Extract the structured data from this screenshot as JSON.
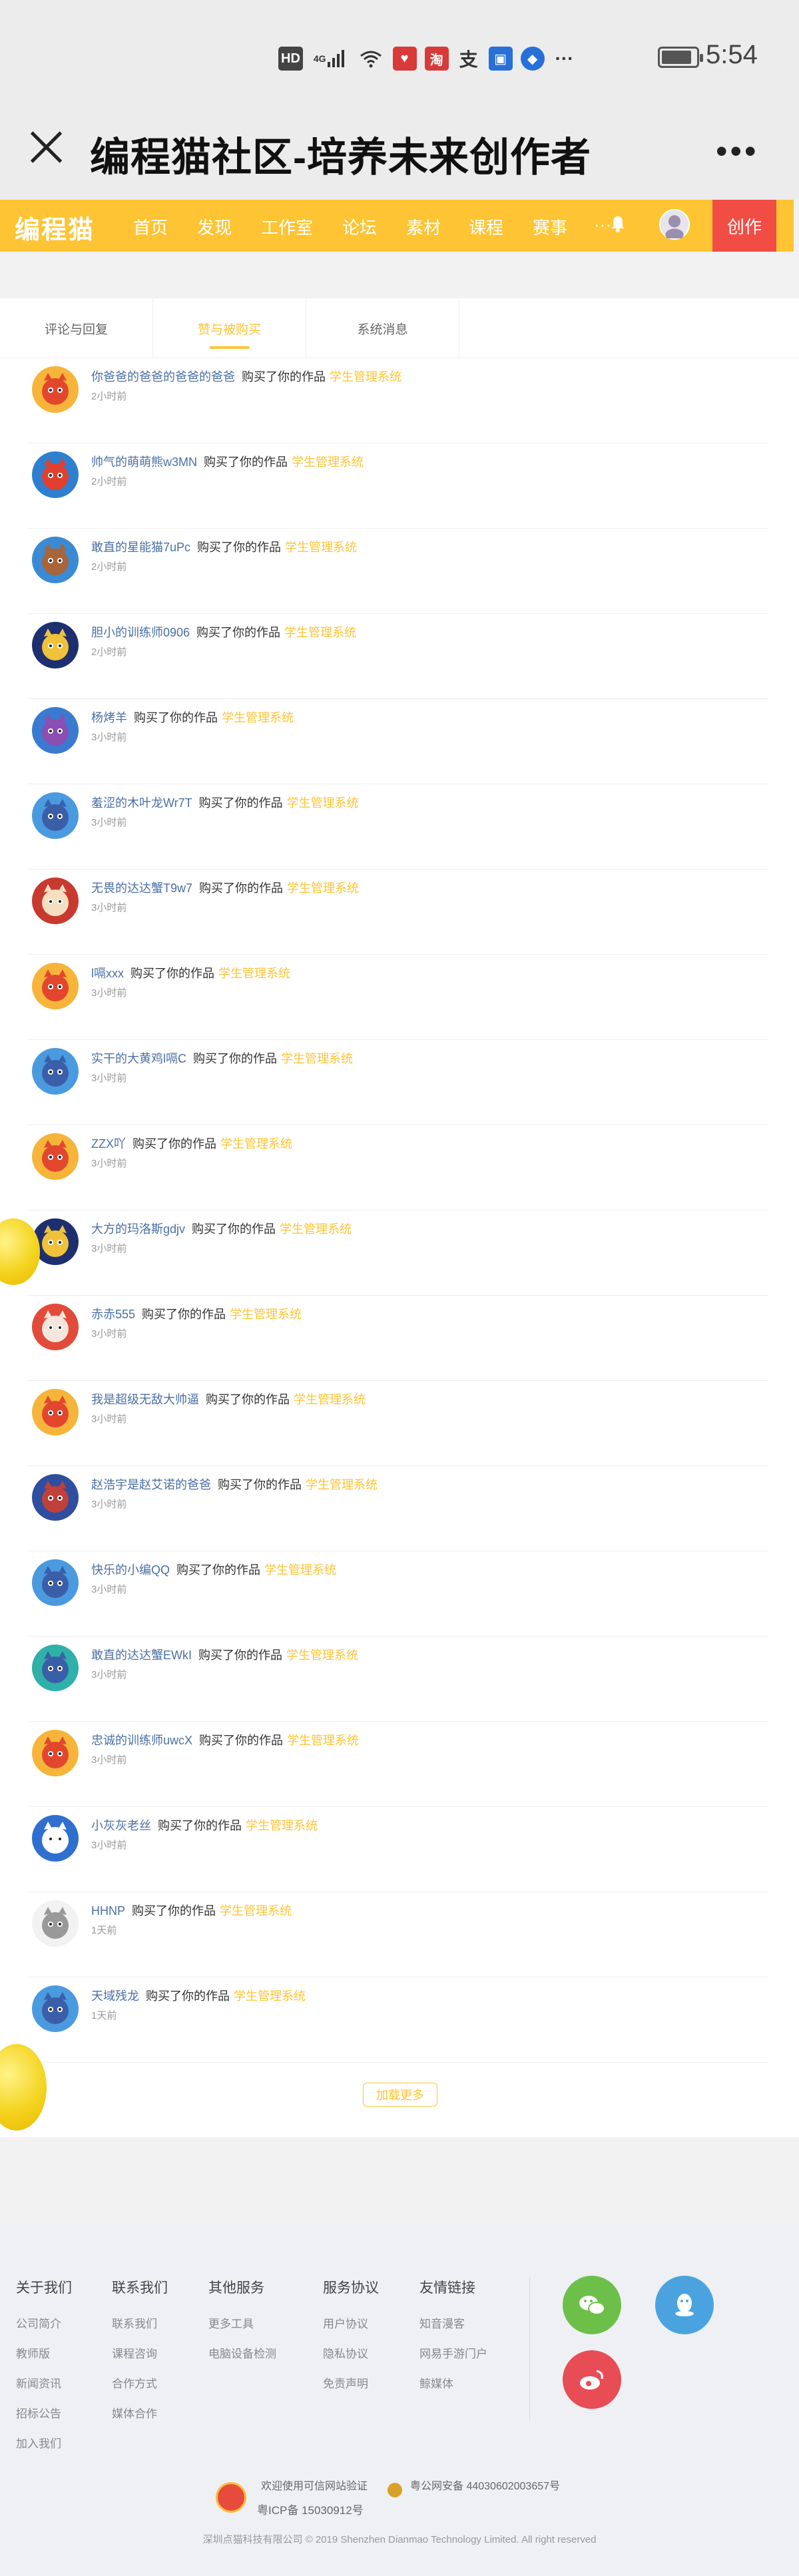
{
  "status_bar": {
    "icons": [
      "HD",
      "4G",
      "wifi",
      "app",
      "淘",
      "支",
      "app",
      "app",
      "···"
    ],
    "battery_level": 0.85,
    "time": "5:54"
  },
  "title_bar": {
    "title": "编程猫社区-培养未来创作者",
    "more": "•••"
  },
  "nav": {
    "logo": "编程猫",
    "items": [
      "首页",
      "发现",
      "工作室",
      "论坛",
      "素材",
      "课程",
      "赛事"
    ],
    "more": "···",
    "create": "创作"
  },
  "tabs": [
    {
      "label": "评论与回复",
      "active": false
    },
    {
      "label": "赞与被购买",
      "active": true
    },
    {
      "label": "系统消息",
      "active": false
    }
  ],
  "notifications": [
    {
      "name": "你爸爸的爸爸的爸爸的爸爸",
      "action": "购买了你的作品",
      "work": "学生管理系统",
      "time": "2小时前",
      "avatar": "red-fox"
    },
    {
      "name": "帅气的萌萌熊w3MN",
      "action": "购买了你的作品",
      "work": "学生管理系统",
      "time": "2小时前",
      "avatar": "blue-hero"
    },
    {
      "name": "敢直的星能猫7uPc",
      "action": "购买了你的作品",
      "work": "学生管理系统",
      "time": "2小时前",
      "avatar": "brown-boy"
    },
    {
      "name": "胆小的训练师0906",
      "action": "购买了你的作品",
      "work": "学生管理系统",
      "time": "2小时前",
      "avatar": "navy-cat"
    },
    {
      "name": "杨烤羊",
      "action": "购买了你的作品",
      "work": "学生管理系统",
      "time": "3小时前",
      "avatar": "purple-cat"
    },
    {
      "name": "羞涩的木叶龙Wr7T",
      "action": "购买了你的作品",
      "work": "学生管理系统",
      "time": "3小时前",
      "avatar": "blue-cat"
    },
    {
      "name": "无畏的达达蟹T9w7",
      "action": "购买了你的作品",
      "work": "学生管理系统",
      "time": "3小时前",
      "avatar": "red-smile"
    },
    {
      "name": "l嗝xxx",
      "action": "购买了你的作品",
      "work": "学生管理系统",
      "time": "3小时前",
      "avatar": "red-fox"
    },
    {
      "name": "实干的大黄鸡l嗝C",
      "action": "购买了你的作品",
      "work": "学生管理系统",
      "time": "3小时前",
      "avatar": "blue-cat"
    },
    {
      "name": "ZZX吖",
      "action": "购买了你的作品",
      "work": "学生管理系统",
      "time": "3小时前",
      "avatar": "red-fox"
    },
    {
      "name": "大方的玛洛斯gdjv",
      "action": "购买了你的作品",
      "work": "学生管理系统",
      "time": "3小时前",
      "avatar": "navy-cat"
    },
    {
      "name": "赤赤555",
      "action": "购买了你的作品",
      "work": "学生管理系统",
      "time": "3小时前",
      "avatar": "red-bunny"
    },
    {
      "name": "我是超级无敌大帅逼",
      "action": "购买了你的作品",
      "work": "学生管理系统",
      "time": "3小时前",
      "avatar": "red-fox"
    },
    {
      "name": "赵浩宇是赵艾诺的爸爸",
      "action": "购买了你的作品",
      "work": "学生管理系统",
      "time": "3小时前",
      "avatar": "dark-cat"
    },
    {
      "name": "快乐的小编QQ",
      "action": "购买了你的作品",
      "work": "学生管理系统",
      "time": "3小时前",
      "avatar": "blue-cat"
    },
    {
      "name": "敢直的达达蟹EWkI",
      "action": "购买了你的作品",
      "work": "学生管理系统",
      "time": "3小时前",
      "avatar": "teal-dino"
    },
    {
      "name": "忠诚的训练师uwcX",
      "action": "购买了你的作品",
      "work": "学生管理系统",
      "time": "3小时前",
      "avatar": "red-fox"
    },
    {
      "name": "小灰灰老丝",
      "action": "购买了你的作品",
      "work": "学生管理系统",
      "time": "3小时前",
      "avatar": "blue-white"
    },
    {
      "name": "HHNP",
      "action": "购买了你的作品",
      "work": "学生管理系统",
      "time": "1天前",
      "avatar": "sketch"
    },
    {
      "name": "天域残龙",
      "action": "购买了你的作品",
      "work": "学生管理系统",
      "time": "1天前",
      "avatar": "blue-cat"
    }
  ],
  "load_more": "加载更多",
  "footer": {
    "columns": [
      {
        "title": "关于我们",
        "items": [
          "公司简介",
          "教师版",
          "新闻资讯",
          "招标公告",
          "加入我们"
        ]
      },
      {
        "title": "联系我们",
        "items": [
          "联系我们",
          "课程咨询",
          "合作方式",
          "媒体合作"
        ]
      },
      {
        "title": "其他服务",
        "items": [
          "更多工具",
          "电脑设备检测"
        ]
      },
      {
        "title": "服务协议",
        "items": [
          "用户协议",
          "隐私协议",
          "免责声明"
        ]
      },
      {
        "title": "友情链接",
        "items": [
          "知音漫客",
          "网易手游门户",
          "鲸媒体"
        ]
      }
    ],
    "social": [
      {
        "name": "wechat",
        "color": "#6cc04a"
      },
      {
        "name": "qq",
        "color": "#4aa3df"
      },
      {
        "name": "weibo",
        "color": "#e84c55"
      }
    ],
    "verify": "欢迎使用可信网站验证",
    "police": "粤公网安备 44030602003657号",
    "icp": "粤ICP备 15030912号",
    "copyright": "深圳点猫科技有限公司  © 2019 Shenzhen Dianmao Technology Limited. All right reserved"
  },
  "colors": {
    "brand": "#fec433",
    "create": "#f24d45",
    "link": "#4a6fa5"
  }
}
